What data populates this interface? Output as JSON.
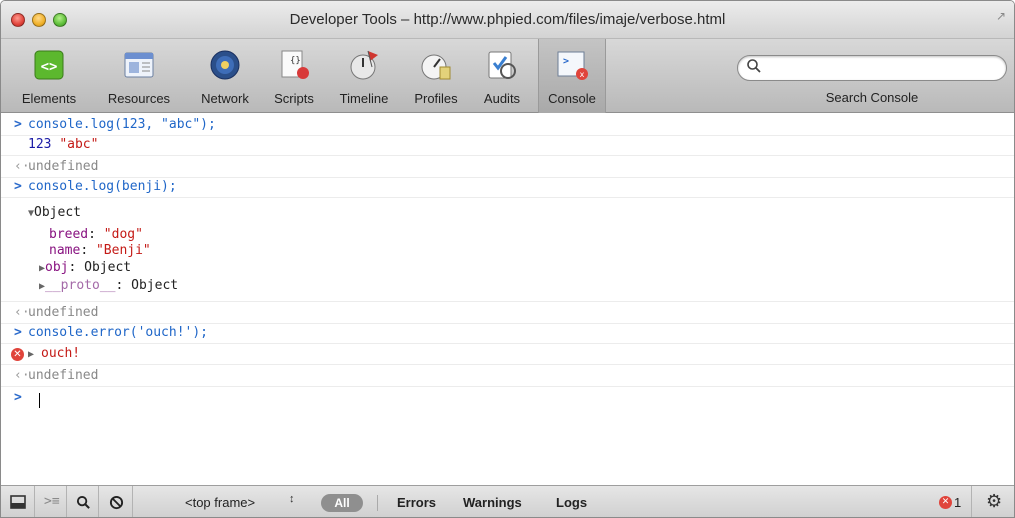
{
  "window": {
    "title": "Developer Tools – http://www.phpied.com/files/imaje/verbose.html"
  },
  "toolbar": {
    "tools": [
      {
        "label": "Elements",
        "icon": "elements-icon"
      },
      {
        "label": "Resources",
        "icon": "resources-icon"
      },
      {
        "label": "Network",
        "icon": "network-icon"
      },
      {
        "label": "Scripts",
        "icon": "scripts-icon"
      },
      {
        "label": "Timeline",
        "icon": "timeline-icon"
      },
      {
        "label": "Profiles",
        "icon": "profiles-icon"
      },
      {
        "label": "Audits",
        "icon": "audits-icon"
      },
      {
        "label": "Console",
        "icon": "console-icon"
      }
    ],
    "active_tool": "Console",
    "search_label": "Search Console",
    "search_placeholder": ""
  },
  "console": {
    "prompt_symbol": ">",
    "result_symbol": "‹·",
    "entries": {
      "cmd1": "console.log(123, \"abc\");",
      "out1_num": "123",
      "out1_str": "\"abc\"",
      "undefined": "undefined",
      "cmd2": "console.log(benji);",
      "obj_header": "Object",
      "breed_key": "breed",
      "breed_val": "\"dog\"",
      "name_key": "name",
      "name_val": "\"Benji\"",
      "obj_key": "obj",
      "obj_val": "Object",
      "proto_key": "__proto__",
      "proto_val": "Object",
      "cmd3": "console.error('ouch!');",
      "error_text": "ouch!"
    }
  },
  "statusbar": {
    "frame_selector": "<top frame>",
    "filter_all": "All",
    "filter_errors": "Errors",
    "filter_warnings": "Warnings",
    "filter_logs": "Logs",
    "error_count": "1"
  },
  "colors": {
    "command_blue": "#1f66c8",
    "string_red": "#c41a16",
    "property_purple": "#881280",
    "error_red": "#e0443b"
  }
}
